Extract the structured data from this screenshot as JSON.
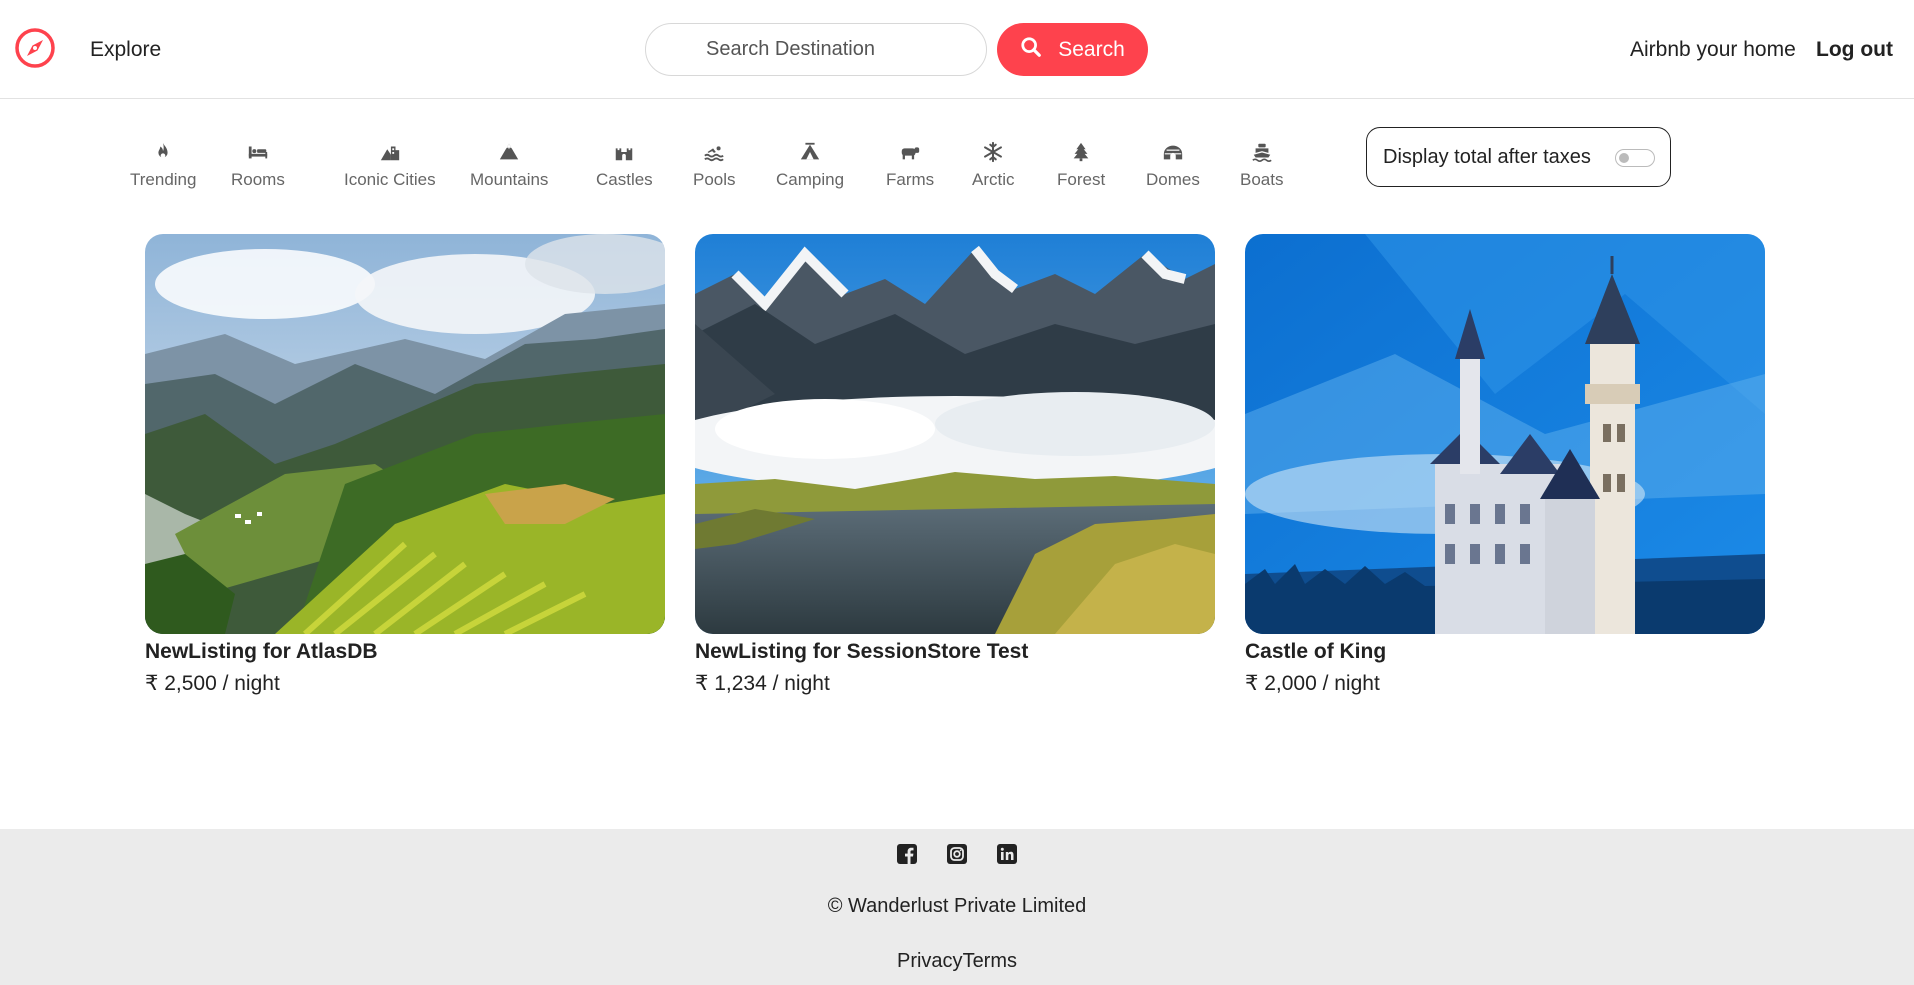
{
  "navbar": {
    "logo_icon": "compass-icon",
    "explore_label": "Explore",
    "search_placeholder": "Search Destination",
    "search_button_label": "Search",
    "search_icon": "search-icon",
    "host_label": "Airbnb your home",
    "logout_label": "Log out",
    "accent_color": "#fe424d"
  },
  "filters": [
    {
      "label": "Trending",
      "icon": "fire-icon"
    },
    {
      "label": "Rooms",
      "icon": "bed-icon"
    },
    {
      "label": "Iconic Cities",
      "icon": "mountain-city-icon"
    },
    {
      "label": "Mountains",
      "icon": "mountain-icon"
    },
    {
      "label": "Castles",
      "icon": "fort-icon"
    },
    {
      "label": "Pools",
      "icon": "person-swimming-icon"
    },
    {
      "label": "Camping",
      "icon": "campground-icon"
    },
    {
      "label": "Farms",
      "icon": "cow-icon"
    },
    {
      "label": "Arctic",
      "icon": "snowflake-icon"
    },
    {
      "label": "Forest",
      "icon": "tree-icon"
    },
    {
      "label": "Domes",
      "icon": "igloo-icon"
    },
    {
      "label": "Boats",
      "icon": "ferry-icon"
    }
  ],
  "tax_toggle": {
    "label": "Display total after taxes",
    "enabled": false
  },
  "listings": [
    {
      "title": "NewListing for AtlasDB",
      "price": "₹ 2,500 / night",
      "image": "terraced-rice-fields-valley"
    },
    {
      "title": "NewListing for SessionStore Test",
      "price": "₹ 1,234 / night",
      "image": "snowy-peaks-lake-clouds"
    },
    {
      "title": "Castle of King",
      "price": "₹ 2,000 / night",
      "image": "fairytale-castle-blue-mountains"
    }
  ],
  "footer": {
    "socials": [
      "facebook-icon",
      "instagram-icon",
      "linkedin-icon"
    ],
    "copyright": "© Wanderlust Private Limited",
    "privacy_label": "Privacy",
    "terms_label": "Terms",
    "background": "#ebebeb"
  }
}
